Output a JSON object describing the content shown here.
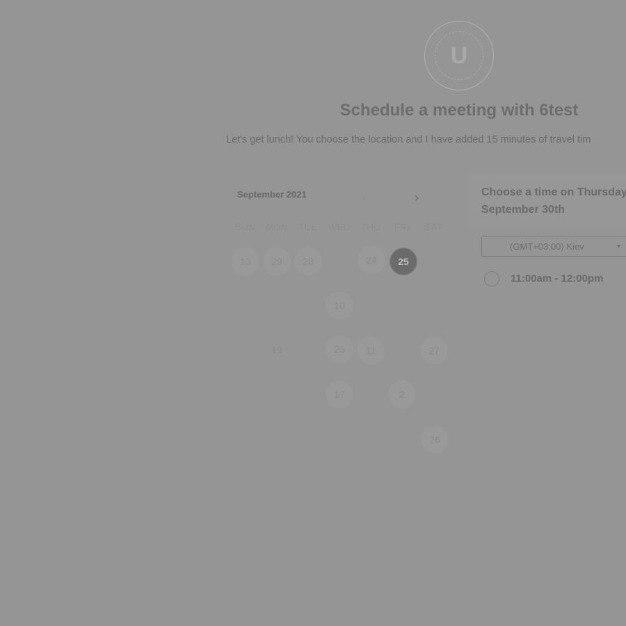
{
  "logo": {
    "letter": "U",
    "icon": "logo-badge-icon"
  },
  "title": "Schedule a meeting with 6test",
  "description": "Let's get lunch! You choose the location and I have added 15 minutes of travel tim",
  "calendar": {
    "month_label": "September 2021",
    "prev_icon": "chevron-left-icon",
    "next_icon": "chevron-right-icon",
    "weekdays": [
      "SUN",
      "MON",
      "TUE",
      "WED",
      "THU",
      "FRI",
      "SAT"
    ],
    "rows": [
      [
        "13",
        "29",
        "28",
        "",
        "24",
        "25",
        ""
      ],
      [
        "",
        "",
        "",
        "10",
        "",
        "",
        ""
      ],
      [
        "",
        "19",
        "",
        "25",
        "11",
        "",
        "27"
      ],
      [
        "",
        "",
        "",
        "17",
        "",
        "2",
        ""
      ],
      [
        "",
        "",
        "",
        "",
        "",
        "",
        "26"
      ]
    ],
    "selected_label": "25"
  },
  "panel": {
    "title_line1": "Choose a time on Thursday",
    "title_line2": "September 30th",
    "timezone": "(GMT+03:00) Kiev",
    "caret_icon": "caret-down-icon",
    "slots": [
      {
        "label": "11:00am - 12:00pm"
      }
    ]
  },
  "colors": {
    "overlay": "#959595",
    "selected_day": "#6b6b6b"
  }
}
